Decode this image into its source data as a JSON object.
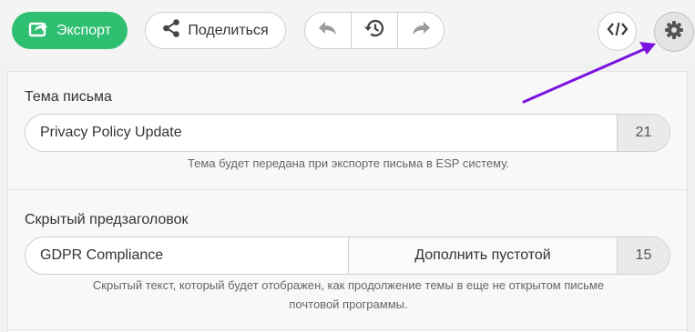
{
  "toolbar": {
    "export_label": "Экспорт",
    "share_label": "Поделиться"
  },
  "subject": {
    "label": "Тема письма",
    "value": "Privacy Policy Update",
    "counter": "21",
    "hint": "Тема будет передана при экспорте письма в ESP систему."
  },
  "preheader": {
    "label": "Скрытый предзаголовок",
    "value": "GDPR Compliance",
    "fill_button": "Дополнить пустотой",
    "counter": "15",
    "hint_line1": "Скрытый текст, который будет отображен, как продолжение темы в еще не открытом письме",
    "hint_line2": "почтовой программы."
  },
  "colors": {
    "accent_green": "#2fbf71",
    "annotation_arrow": "#7a12e0"
  }
}
